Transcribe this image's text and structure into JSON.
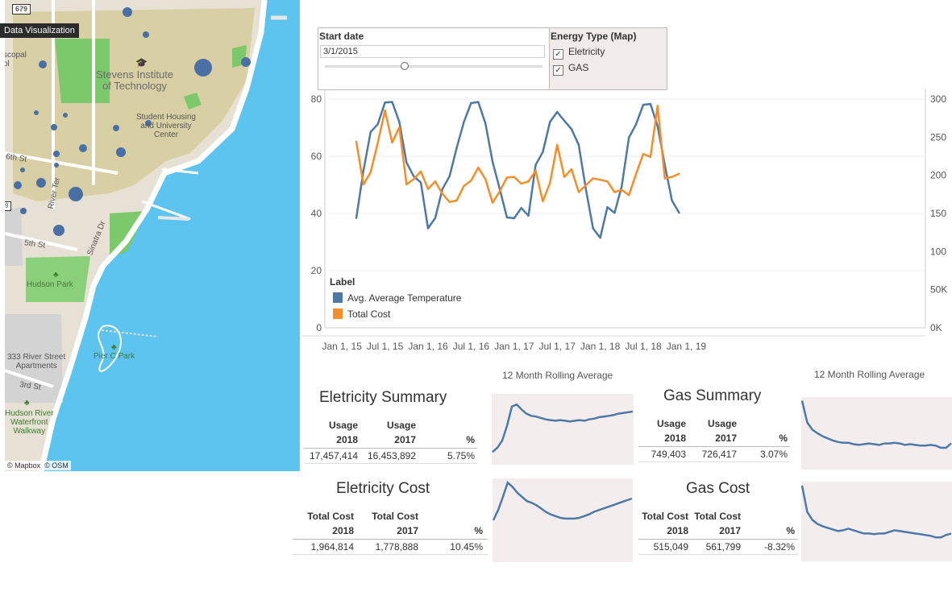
{
  "map": {
    "tooltip": "Data Visualization",
    "route_shield": "679",
    "attribution": [
      "© Mapbox",
      "© OSM"
    ],
    "labels": {
      "stevens": "Stevens Institute\nof Technology",
      "student_housing": "Student Housing\nand University\nCenter",
      "hudson_park": "Hudson Park",
      "river_st_apts": "333 River Street\nApartments",
      "pier_c_park": "Pier C Park",
      "waterfront": "Hudson River\nWaterfront\nWalkway",
      "sixth_st": "6th St",
      "fifth_st": "5th St",
      "third_st": "3rd St",
      "river_ter": "River Ter",
      "sinatra_dr": "Sinatra Dr",
      "episcopal": "scopal\nol",
      "shield_small": "9"
    },
    "colors": {
      "water": "#5cc4ee",
      "land": "#e7e0d4",
      "campus": "#d8cfa4",
      "park": "#7bc96a",
      "dot": "#4a6fa5"
    }
  },
  "filters": {
    "start_date": {
      "title": "Start date",
      "value": "3/1/2015"
    },
    "energy_type": {
      "title": "Energy Type (Map)",
      "options": [
        {
          "label": "Eletricity",
          "checked": true
        },
        {
          "label": "GAS",
          "checked": true
        }
      ]
    }
  },
  "chart_data": {
    "type": "line",
    "x_ticks": [
      "Jan 1, 15",
      "Jul 1, 15",
      "Jan 1, 16",
      "Jul 1, 16",
      "Jan 1, 17",
      "Jul 1, 17",
      "Jan 1, 18",
      "Jul 1, 18",
      "Jan 1, 19"
    ],
    "y_left_ticks": [
      "0",
      "20",
      "40",
      "60",
      "80"
    ],
    "y_left_range": [
      0,
      80
    ],
    "y_right_ticks": [
      "0K",
      "50K",
      "100",
      "150",
      "200",
      "250",
      "300"
    ],
    "y_right_range": [
      0,
      300000
    ],
    "legend_title": "Label",
    "legend_position": "lower-left",
    "x": [
      "2015-03",
      "2015-04",
      "2015-05",
      "2015-06",
      "2015-07",
      "2015-08",
      "2015-09",
      "2015-10",
      "2015-11",
      "2015-12",
      "2016-01",
      "2016-02",
      "2016-03",
      "2016-04",
      "2016-05",
      "2016-06",
      "2016-07",
      "2016-08",
      "2016-09",
      "2016-10",
      "2016-11",
      "2016-12",
      "2017-01",
      "2017-02",
      "2017-03",
      "2017-04",
      "2017-05",
      "2017-06",
      "2017-07",
      "2017-08",
      "2017-09",
      "2017-10",
      "2017-11",
      "2017-12",
      "2018-01",
      "2018-02",
      "2018-03",
      "2018-04",
      "2018-05",
      "2018-06",
      "2018-07",
      "2018-08",
      "2018-09",
      "2018-10",
      "2018-11",
      "2018-12"
    ],
    "series": [
      {
        "name": "Avg. Average Temperature",
        "color": "#4e79a7",
        "axis": "left",
        "values": [
          38.4,
          55,
          68.5,
          71.2,
          78.8,
          79,
          72,
          57.8,
          53,
          50.8,
          34.8,
          38.4,
          48.5,
          53,
          63,
          72,
          78.6,
          79,
          71.5,
          58,
          48.5,
          38.6,
          38.3,
          41.9,
          39.2,
          57,
          61.5,
          72,
          75.5,
          72.4,
          69.5,
          64,
          48.5,
          34.8,
          31.5,
          42.2,
          40.2,
          49.5,
          66.5,
          71.2,
          78,
          78.3,
          70.5,
          57,
          44.5,
          40.2
        ]
      },
      {
        "name": "Total Cost",
        "color": "#f28e2b",
        "axis": "right",
        "values": [
          244000,
          188000,
          204000,
          243000,
          285000,
          243000,
          263000,
          188000,
          195000,
          205000,
          182000,
          192000,
          176000,
          165000,
          167000,
          186000,
          193000,
          210000,
          195000,
          164000,
          179000,
          197000,
          198000,
          189000,
          192000,
          206000,
          166000,
          190000,
          240000,
          198000,
          208000,
          178000,
          187000,
          196000,
          194000,
          192000,
          178000,
          181000,
          174000,
          202000,
          228000,
          224000,
          291000,
          196000,
          198000,
          202000
        ]
      }
    ]
  },
  "summaries": {
    "rolling_caption": "12 Month Rolling Average",
    "elec_summary": {
      "title": "Eletricity Summary",
      "h1a": "Usage",
      "h1b": "2018",
      "h2a": "Usage",
      "h2b": "2017",
      "h3": "%",
      "v1": "17,457,414",
      "v2": "16,453,892",
      "v3": "5.75%",
      "spark": [
        0.18,
        0.24,
        0.34,
        0.55,
        0.82,
        0.85,
        0.78,
        0.72,
        0.69,
        0.68,
        0.66,
        0.64,
        0.63,
        0.62,
        0.63,
        0.62,
        0.61,
        0.62,
        0.63,
        0.62,
        0.64,
        0.65,
        0.67,
        0.68,
        0.69,
        0.7,
        0.72,
        0.73,
        0.74,
        0.75
      ]
    },
    "gas_summary": {
      "title": "Gas Summary",
      "h1a": "Usage",
      "h1b": "2018",
      "h2a": "Usage",
      "h2b": "2017",
      "h3": "%",
      "v1": "749,403",
      "v2": "726,417",
      "v3": "3.07%",
      "spark": [
        0.95,
        0.65,
        0.55,
        0.5,
        0.46,
        0.43,
        0.4,
        0.38,
        0.37,
        0.37,
        0.35,
        0.34,
        0.35,
        0.36,
        0.35,
        0.34,
        0.36,
        0.36,
        0.37,
        0.36,
        0.34,
        0.35,
        0.34,
        0.33,
        0.33,
        0.34,
        0.33,
        0.3,
        0.3,
        0.36
      ]
    },
    "elec_cost": {
      "title": "Eletricity Cost",
      "h1a": "Total Cost",
      "h1b": "2018",
      "h2a": "Total Cost",
      "h2b": "2017",
      "h3": "%",
      "v1": "1,964,814",
      "v2": "1,778,888",
      "v3": "10.45%",
      "spark": [
        0.5,
        0.62,
        0.78,
        0.95,
        0.9,
        0.83,
        0.78,
        0.73,
        0.71,
        0.68,
        0.64,
        0.6,
        0.57,
        0.55,
        0.53,
        0.52,
        0.52,
        0.52,
        0.53,
        0.55,
        0.57,
        0.6,
        0.62,
        0.64,
        0.66,
        0.68,
        0.7,
        0.72,
        0.74,
        0.76
      ]
    },
    "gas_cost": {
      "title": "Gas Cost",
      "h1a": "Total Cost",
      "h1b": "2018",
      "h2a": "Total Cost",
      "h2b": "2017",
      "h3": "%",
      "v1": "515,049",
      "v2": "561,799",
      "v3": "-8.32%",
      "spark": [
        0.95,
        0.62,
        0.52,
        0.47,
        0.44,
        0.42,
        0.4,
        0.38,
        0.39,
        0.41,
        0.39,
        0.37,
        0.35,
        0.35,
        0.34,
        0.35,
        0.35,
        0.37,
        0.39,
        0.38,
        0.37,
        0.36,
        0.35,
        0.34,
        0.33,
        0.32,
        0.3,
        0.3,
        0.33,
        0.35
      ]
    }
  }
}
